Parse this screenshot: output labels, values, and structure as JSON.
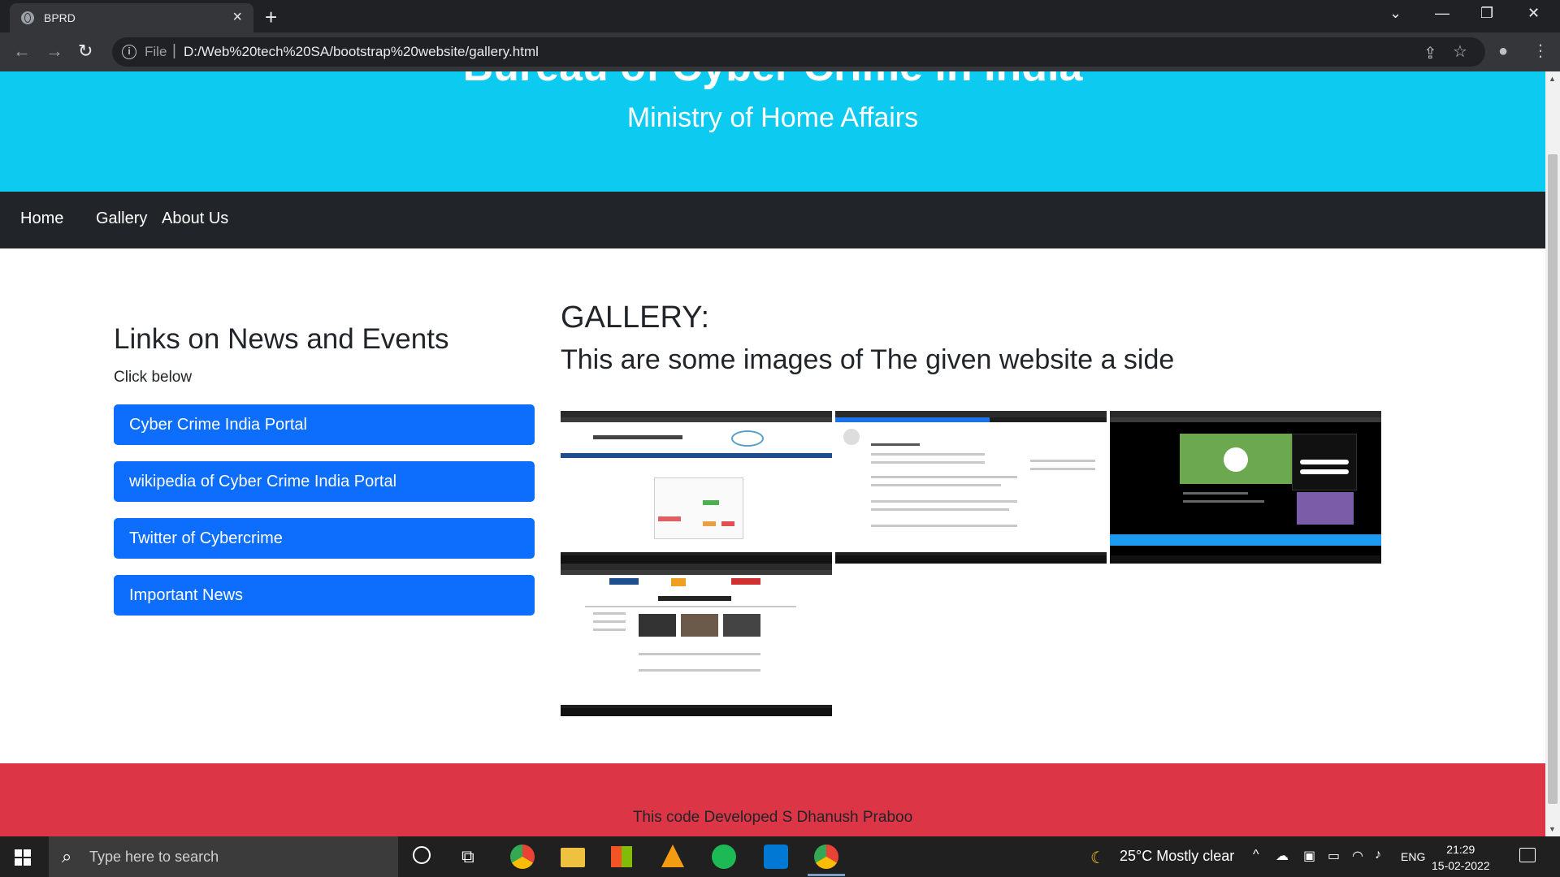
{
  "browser": {
    "tab_title": "BPRD",
    "url_scheme": "File",
    "url": "D:/Web%20tech%20SA/bootstrap%20website/gallery.html"
  },
  "hero": {
    "title": "Bureau of Cyber Crime in India",
    "subtitle": "Ministry of Home Affairs"
  },
  "navbar": {
    "items": [
      "Home",
      "Gallery",
      "About Us"
    ]
  },
  "sidebar": {
    "heading": "Links on News and Events",
    "subtext": "Click below",
    "links": [
      "Cyber Crime India Portal",
      "wikipedia of Cyber Crime India Portal",
      "Twitter of Cybercrime",
      "Important News"
    ]
  },
  "gallery": {
    "title": "GALLERY:",
    "subtitle": "This are some images of The given website a side"
  },
  "footer": {
    "text": "This code Developed S Dhanush Praboo"
  },
  "taskbar": {
    "search_placeholder": "Type here to search",
    "weather": "25°C  Mostly clear",
    "language": "ENG",
    "time": "21:29",
    "date": "15-02-2022"
  },
  "colors": {
    "hero_bg": "#0dcaf0",
    "navbar_bg": "#212529",
    "link_button_bg": "#0d6efd",
    "footer_bg": "#dc3545"
  }
}
